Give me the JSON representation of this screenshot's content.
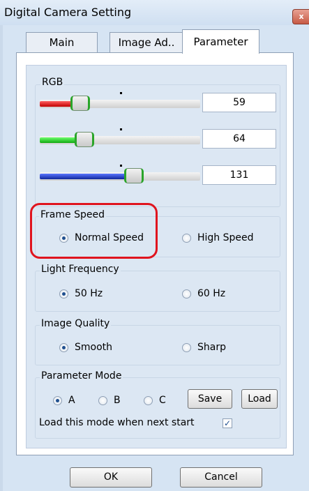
{
  "window": {
    "title": "Digital Camera Setting",
    "close_glyph": "x"
  },
  "tabs": [
    {
      "label": "Main",
      "active": false
    },
    {
      "label": "Image Ad..",
      "active": false
    },
    {
      "label": "Parameter",
      "active": true
    }
  ],
  "rgb": {
    "title": "RGB",
    "sliders": [
      {
        "channel": "red",
        "value": "59",
        "color": "#d42020"
      },
      {
        "channel": "green",
        "value": "64",
        "color": "#22c322"
      },
      {
        "channel": "blue",
        "value": "131",
        "color": "#1f3fc0"
      }
    ]
  },
  "frame_speed": {
    "title": "Frame Speed",
    "options": [
      {
        "label": "Normal Speed",
        "selected": true
      },
      {
        "label": "High Speed",
        "selected": false
      }
    ]
  },
  "light_frequency": {
    "title": "Light Frequency",
    "options": [
      {
        "label": "50 Hz",
        "selected": true
      },
      {
        "label": "60 Hz",
        "selected": false
      }
    ]
  },
  "image_quality": {
    "title": "Image Quality",
    "options": [
      {
        "label": "Smooth",
        "selected": true
      },
      {
        "label": "Sharp",
        "selected": false
      }
    ]
  },
  "parameter_mode": {
    "title": "Parameter Mode",
    "options": [
      {
        "label": "A",
        "selected": true
      },
      {
        "label": "B",
        "selected": false
      },
      {
        "label": "C",
        "selected": false
      }
    ],
    "save_label": "Save",
    "load_label": "Load",
    "load_on_start_label": "Load this mode when next start",
    "load_on_start_checked": true,
    "check_glyph": "✓"
  },
  "footer": {
    "ok_label": "OK",
    "cancel_label": "Cancel"
  },
  "colors": {
    "highlight": "#e0141e",
    "accent": "#1f4f8f"
  }
}
